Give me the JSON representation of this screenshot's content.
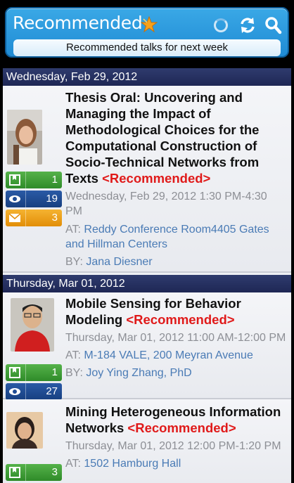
{
  "header": {
    "title": "Recommended",
    "subtitle": "Recommended talks for next week",
    "icons": [
      "star-icon",
      "loading-spinner-icon",
      "refresh-icon",
      "search-icon"
    ]
  },
  "colors": {
    "header_bg": "#2b9ce0",
    "date_bar": "#27305f",
    "recommended": "#e01a1a",
    "link": "#4a7bb5",
    "badge_green": "#3f9c37",
    "badge_blue": "#1f4c95",
    "badge_orange": "#eea01d"
  },
  "sections": [
    {
      "date": "Wednesday, Feb 29, 2012",
      "talks": [
        {
          "title": "Thesis Oral: Uncovering and Managing the Impact of Methodological Choices for the Computational Construction of Socio-Technical Networks from Texts",
          "recommended": "<Recommended>",
          "time": "Wednesday, Feb 29, 2012 1:30 PM-4:30 PM",
          "at_label": "AT:",
          "location": "Reddy Conference Room4405 Gates and Hillman Centers",
          "by_label": "BY:",
          "speaker": "Jana Diesner",
          "bookmarks": "1",
          "views": "19",
          "emails": "3"
        }
      ]
    },
    {
      "date": "Thursday, Mar 01, 2012",
      "talks": [
        {
          "title": "Mobile Sensing for Behavior Modeling",
          "recommended": "<Recommended>",
          "time": "Thursday, Mar 01, 2012 11:00 AM-12:00 PM",
          "at_label": "AT:",
          "location": "M-184 VALE, 200 Meyran Avenue",
          "by_label": "BY:",
          "speaker": "Joy Ying Zhang, PhD",
          "bookmarks": "1",
          "views": "27"
        },
        {
          "title": "Mining Heterogeneous Information Networks",
          "recommended": "<Recommended>",
          "time": "Thursday, Mar 01, 2012 12:00 PM-1:20 PM",
          "at_label": "AT:",
          "location": "1502 Hamburg Hall",
          "bookmarks": "3"
        }
      ]
    }
  ]
}
